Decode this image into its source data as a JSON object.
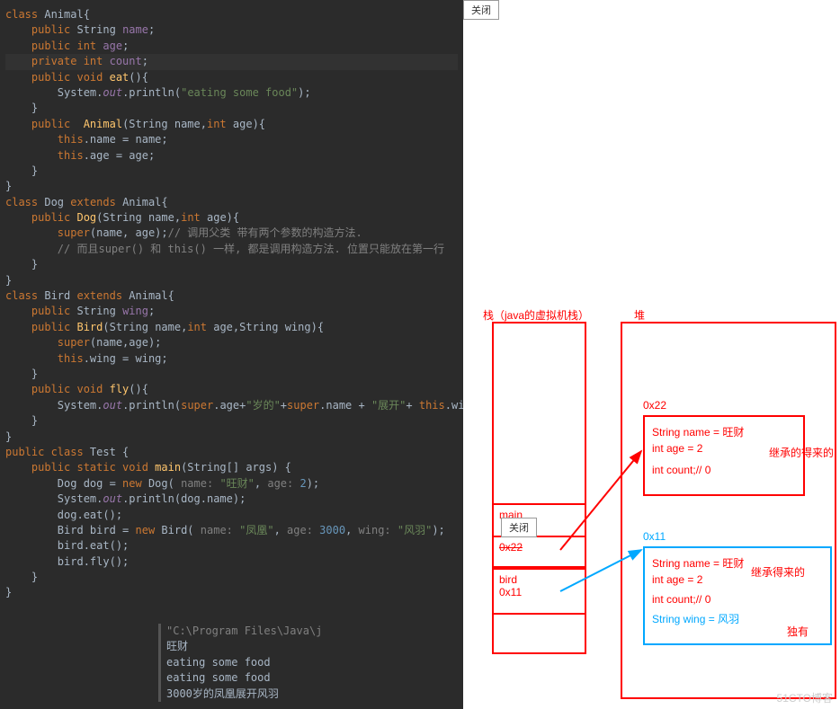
{
  "code": {
    "l01a": "class ",
    "l01b": "Animal",
    "l01c": "{",
    "l02a": "    public ",
    "l02b": "String ",
    "l02c": "name",
    "l02d": ";",
    "l03a": "    public ",
    "l03b": "int ",
    "l03c": "age",
    "l03d": ";",
    "l04a": "    private ",
    "l04b": "int ",
    "l04c": "count",
    "l04d": ";",
    "l05": "",
    "l06a": "    public ",
    "l06b": "void ",
    "l06c": "eat",
    "l06d": "(){",
    "l07a": "        System.",
    "l07b": "out",
    "l07c": ".println(",
    "l07d": "\"eating some food\"",
    "l07e": ");",
    "l08": "    }",
    "l09a": "    public  ",
    "l09b": "Animal",
    "l09c": "(String name,",
    "l09d": "int ",
    "l09e": "age){",
    "l10a": "        this",
    "l10b": ".name = name;",
    "l11a": "        this",
    "l11b": ".age = age;",
    "l12": "    }",
    "l13": "}",
    "l14a": "class ",
    "l14b": "Dog ",
    "l14c": "extends ",
    "l14d": "Animal{",
    "l15a": "    public ",
    "l15b": "Dog",
    "l15c": "(String name,",
    "l15d": "int ",
    "l15e": "age){",
    "l16a": "        super",
    "l16b": "(name, age);",
    "l16c": "// 调用父类 带有两个参数的构造方法.",
    "l17": "        // 而且super() 和 this() 一样, 都是调用构造方法. 位置只能放在第一行",
    "l18": "    }",
    "l19": "}",
    "l20": "",
    "l21a": "class ",
    "l21b": "Bird ",
    "l21c": "extends ",
    "l21d": "Animal{",
    "l22a": "    public ",
    "l22b": "String ",
    "l22c": "wing",
    "l22d": ";",
    "l23": "",
    "l24a": "    public ",
    "l24b": "Bird",
    "l24c": "(String name,",
    "l24d": "int ",
    "l24e": "age,String wing){",
    "l25a": "        super",
    "l25b": "(name,age);",
    "l26a": "        this",
    "l26b": ".wing = wing;",
    "l27": "    }",
    "l28a": "    public ",
    "l28b": "void ",
    "l28c": "fly",
    "l28d": "(){",
    "l29a": "        System.",
    "l29b": "out",
    "l29c": ".println(",
    "l29d": "super",
    "l29e": ".age+",
    "l29f": "\"岁的\"",
    "l29g": "+",
    "l29h": "super",
    "l29i": ".name + ",
    "l29j": "\"展开\"",
    "l29k": "+ ",
    "l29l": "this",
    "l29m": ".wing );",
    "l30": "    }",
    "l31": "}",
    "l32": "",
    "l33a": "public class ",
    "l33b": "Test ",
    "l33c": "{",
    "l34a": "    public static ",
    "l34b": "void ",
    "l34c": "main",
    "l34d": "(String[] args) {",
    "l35a": "        Dog dog = ",
    "l35b": "new ",
    "l35c": "Dog( ",
    "l35d": "name: ",
    "l35e": "\"旺财\"",
    "l35f": ", ",
    "l35g": "age: ",
    "l35h": "2",
    "l35i": ");",
    "l36a": "        System.",
    "l36b": "out",
    "l36c": ".println(dog.name);",
    "l37": "        dog.eat();",
    "l38": "",
    "l39a": "        Bird bird = ",
    "l39b": "new ",
    "l39c": "Bird( ",
    "l39d": "name: ",
    "l39e": "\"凤凰\"",
    "l39f": ", ",
    "l39g": "age: ",
    "l39h": "3000",
    "l39i": ", ",
    "l39j": "wing: ",
    "l39k": "\"风羽\"",
    "l39l": ");",
    "l40": "        bird.eat();",
    "l41": "        bird.fly();",
    "l42": "    }",
    "l43": "}"
  },
  "console": {
    "path": "\"C:\\Program Files\\Java\\j",
    "o1": "旺财",
    "o2": "eating some food",
    "o3": "",
    "o4": "eating some food",
    "o5": "3000岁的凤凰展开风羽"
  },
  "diagram": {
    "stack_title": "栈（java的虚拟机栈）",
    "heap_title": "堆",
    "stack_main": "main",
    "stack_dog_addr": "0x22",
    "stack_bird_var": "bird",
    "stack_bird_addr": "0x11",
    "close_btn": "关闭",
    "obj1_addr": "0x22",
    "obj1_l1": "String name = 旺财",
    "obj1_l2": "int age = 2",
    "obj1_l3": "int count;// 0",
    "obj1_note": "继承的得来的",
    "obj2_addr": "0x11",
    "obj2_l1": "String name = 旺财",
    "obj2_l2": "int age = 2",
    "obj2_l3": "int count;// 0",
    "obj2_wing": "String wing = 风羽",
    "obj2_note": "继承得来的",
    "wing_note": "独有"
  },
  "watermark": "51CTO博客"
}
